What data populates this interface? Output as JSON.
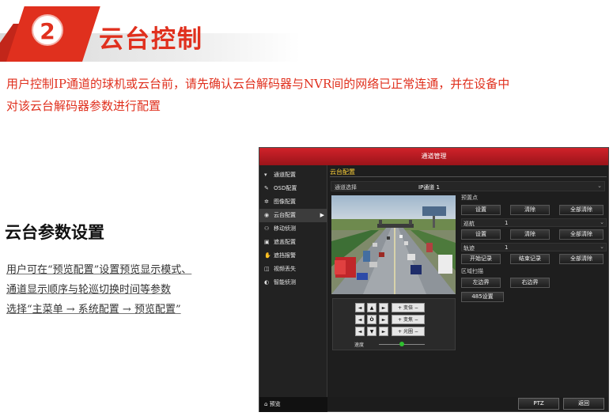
{
  "header": {
    "number": "2",
    "title": "云台控制"
  },
  "intro": {
    "line1": "用户控制IP通道的球机或云台前，请先确认云台解码器与NVR间的网络已正常连通，并在设备中",
    "line2": "对该云台解码器参数进行配置"
  },
  "section": {
    "title": "云台参数设置",
    "lines": [
      "用户可在“预览配置”设置预览显示模式、",
      "通道显示顺序与轮巡切换时间等参数",
      "选择“主菜单 → 系统配置 → 预览配置”"
    ]
  },
  "dvr": {
    "window_title": "通道管理",
    "sidebar": [
      {
        "label": "通道配置",
        "icon": "camera-icon"
      },
      {
        "label": "OSD配置",
        "icon": "pencil-icon"
      },
      {
        "label": "图像配置",
        "icon": "image-icon"
      },
      {
        "label": "云台配置",
        "icon": "ptz-icon",
        "active": true
      },
      {
        "label": "移动侦测",
        "icon": "motion-icon"
      },
      {
        "label": "遮盖配置",
        "icon": "mask-icon"
      },
      {
        "label": "遮挡报警",
        "icon": "hand-icon"
      },
      {
        "label": "视频丢失",
        "icon": "video-loss-icon"
      },
      {
        "label": "智能侦测",
        "icon": "smart-icon"
      }
    ],
    "sidebar_bottom": "预览",
    "tab": "云台配置",
    "channel_label": "通道选择",
    "channel_value": "IP通道 1",
    "preset": {
      "label": "预置点",
      "buttons": [
        "设置",
        "清除",
        "全部清除"
      ]
    },
    "patrol": {
      "label": "巡航",
      "number": "1",
      "buttons": [
        "设置",
        "清除",
        "全部清除"
      ]
    },
    "pattern": {
      "label": "轨迹",
      "number": "1",
      "buttons": [
        "开始记录",
        "结束记录",
        "全部清除"
      ]
    },
    "scan": {
      "label": "区域扫描",
      "buttons": [
        "左边界",
        "右边界"
      ]
    },
    "rs485": "485设置",
    "ptz_controls": {
      "dirs": [
        "◄",
        "▲",
        "►",
        "◄",
        "Ò",
        "►",
        "◄",
        "▼",
        "►"
      ],
      "zoom": "变倍",
      "focus": "变焦",
      "iris": "光圈",
      "speed_label": "速度",
      "speed_level": 0.5
    },
    "bottom_buttons": [
      "PTZ",
      "返回"
    ]
  }
}
